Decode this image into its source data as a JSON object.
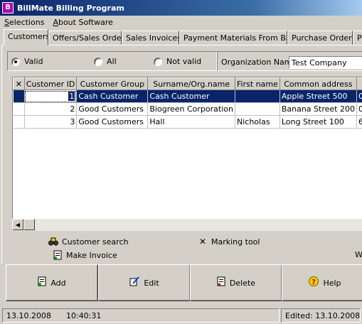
{
  "window": {
    "title": "BillMate Billing Program",
    "icon": "app-logo-icon"
  },
  "menu": [
    {
      "label": "Selections",
      "mnemonic": "S",
      "rest": "elections"
    },
    {
      "label": "About Software",
      "mnemonic": "A",
      "rest": "bout Software"
    }
  ],
  "tabs": [
    "Customers",
    "Offers/Sales Orders",
    "Sales Invoices",
    "Payment Materials From Bank",
    "Purchase Orders",
    "P"
  ],
  "filter": {
    "options": [
      "Valid",
      "All",
      "Not valid"
    ],
    "selected": "Valid",
    "org_label": "Organization Name:",
    "org_value": "Test Company"
  },
  "grid": {
    "columns": [
      "Customer ID",
      "Customer Group",
      "Surname/Org.name",
      "First name",
      "Common address",
      ""
    ],
    "rows": [
      {
        "id": "1",
        "group": "Cash Customer",
        "surname": "Cash Customer",
        "first": "",
        "address": "Apple Street 500",
        "extra": "0"
      },
      {
        "id": "2",
        "group": "Good Customers",
        "surname": "Biogreen Corporation",
        "first": "",
        "address": "Banana Street 200",
        "extra": "0"
      },
      {
        "id": "3",
        "group": "Good Customers",
        "surname": "Hall",
        "first": "Nicholas",
        "address": "Long Street 100",
        "extra": "6"
      }
    ],
    "selected_row": 0
  },
  "actions": {
    "customer_search": "Customer search",
    "marking_tool": "Marking tool",
    "make_invoice": "Make Invoice",
    "clipped_text": "W"
  },
  "buttons": {
    "add": "Add",
    "edit": "Edit",
    "delete": "Delete",
    "help": "Help"
  },
  "status": {
    "date": "13.10.2008",
    "time": "10:40:31",
    "edited": "Edited: 13.10.2008"
  },
  "colors": {
    "titlebar": "#0a246a",
    "selection": "#0a246a",
    "face": "#d4d0c8"
  }
}
